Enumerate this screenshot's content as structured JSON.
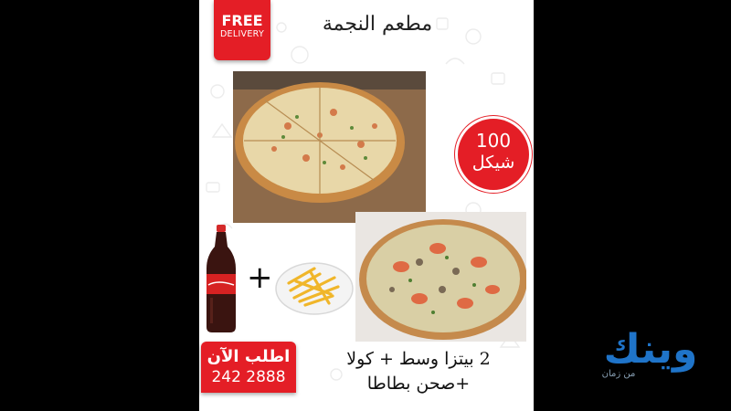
{
  "flyer": {
    "free_delivery": {
      "line1": "FREE",
      "line2": "DELIVERY"
    },
    "restaurant_name": "مطعم النجمة",
    "price": {
      "amount": "100",
      "currency": "شيكل"
    },
    "plus": "+",
    "order": {
      "label": "اطلب الآن",
      "phone": "242 2888"
    },
    "offer": {
      "line1": "2 بيتزا وسط + كولا",
      "line2": "+صحن بطاطا"
    },
    "colors": {
      "brand_red": "#e41e26",
      "background": "#ffffff"
    },
    "images": [
      "pizza-photo",
      "pizza-photo",
      "cola-bottle",
      "fries-plate"
    ]
  },
  "watermark": {
    "logo_text": "وينك",
    "tagline": "من زمان",
    "color": "#1f74c9"
  }
}
